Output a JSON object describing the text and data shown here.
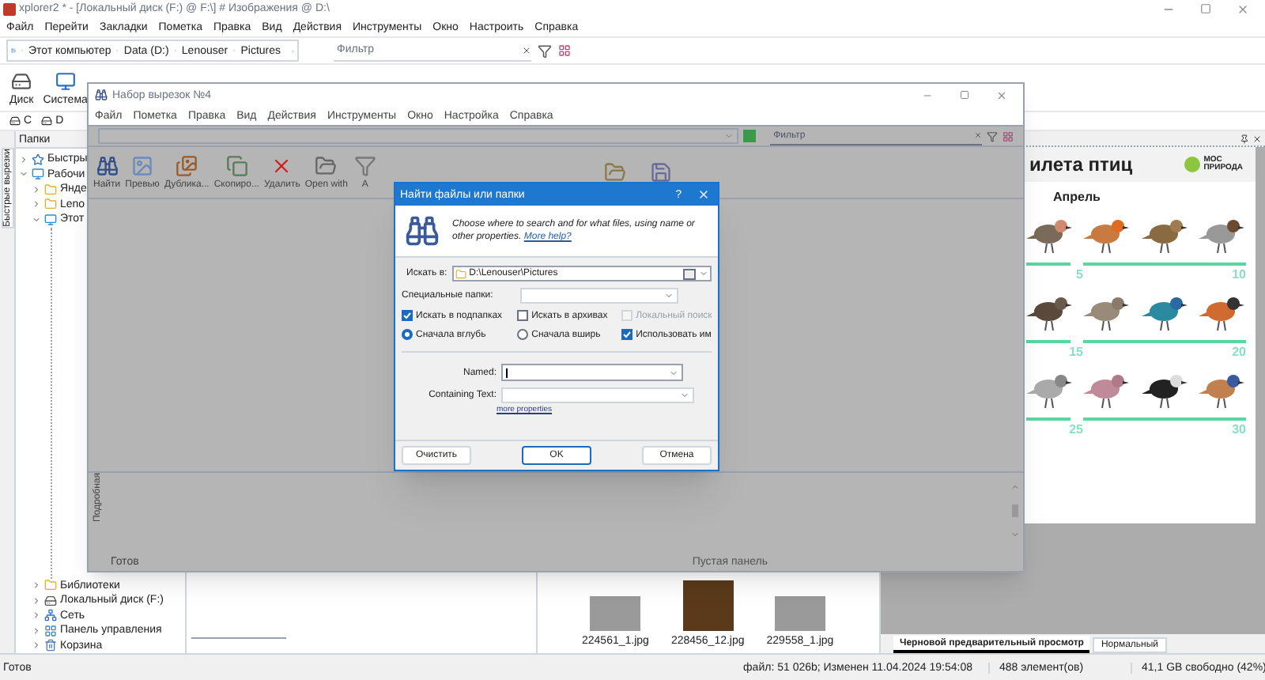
{
  "main_window": {
    "title": "xplorer2 * - [Локальный диск (F:) @ F:\\] # Изображения @ D:\\",
    "menu": [
      "Файл",
      "Перейти",
      "Закладки",
      "Пометка",
      "Правка",
      "Вид",
      "Действия",
      "Инструменты",
      "Окно",
      "Настроить",
      "Справка"
    ],
    "address": [
      "Этот компьютер",
      "Data (D:)",
      "Lenouser",
      "Pictures"
    ],
    "filter": {
      "placeholder": "Фильтр"
    },
    "toolbar": [
      {
        "label": "Диск",
        "kind": "drive"
      },
      {
        "label": "Система",
        "kind": "computer"
      }
    ],
    "drives": [
      "C",
      "D"
    ],
    "side_tab": "Быстрые вырезки",
    "folders": {
      "title": "Папки",
      "tree": [
        {
          "label": "Быстры",
          "expanded": false,
          "kind": "star"
        },
        {
          "label": "Рабочи",
          "expanded": true,
          "kind": "desktop",
          "children": [
            {
              "label": "Янде",
              "expanded": false,
              "kind": "folder"
            },
            {
              "label": "Leno",
              "expanded": false,
              "kind": "folder"
            },
            {
              "label": "Этот",
              "expanded": true,
              "kind": "desktop"
            },
            {
              "label": "Библиотеки",
              "expanded": false,
              "kind": "folder"
            },
            {
              "label": "Локальный диск (F:)",
              "expanded": false,
              "kind": "drive"
            },
            {
              "label": "Сеть",
              "expanded": false,
              "kind": "network"
            },
            {
              "label": "Панель управления",
              "expanded": false,
              "kind": "panel"
            },
            {
              "label": "Корзина",
              "expanded": false,
              "kind": "trash"
            }
          ]
        }
      ]
    },
    "thumbnails": [
      {
        "name": "224561_1.jpg"
      },
      {
        "name": "228456_12.jpg"
      },
      {
        "name": "229558_1.jpg"
      }
    ],
    "preview": {
      "title": "илета птиц",
      "logo": [
        "МОС",
        "ПРИРОДА"
      ],
      "month": "Апрель",
      "rows": [
        {
          "numbers": [
            "5",
            "10"
          ]
        },
        {
          "numbers": [
            "15",
            "20"
          ]
        },
        {
          "numbers": [
            "25",
            "30"
          ]
        }
      ]
    },
    "preview_tabs": [
      {
        "label": "Черновой предварительный просмотр",
        "selected": true
      },
      {
        "label": "Нормальный",
        "selected": false
      }
    ],
    "status_bar": [
      "Готов",
      "файл: 51 026b; Изменен 11.04.2024 19:54:08",
      "488 элемент(ов)",
      "41,1 GB свободно (42%)"
    ]
  },
  "clip_window": {
    "title": "Набор вырезок №4",
    "menu": [
      "Файл",
      "Пометка",
      "Правка",
      "Вид",
      "Действия",
      "Инструменты",
      "Окно",
      "Настройка",
      "Справка"
    ],
    "filter": {
      "placeholder": "Фильтр"
    },
    "toolbar": [
      {
        "label": "Найти",
        "kind": "binoculars"
      },
      {
        "label": "Превью",
        "kind": "preview"
      },
      {
        "label": "Дублика...",
        "kind": "photos"
      },
      {
        "label": "Скопиро...",
        "kind": "copy"
      },
      {
        "label": "Удалить",
        "kind": "delete"
      },
      {
        "label": "Open with",
        "kind": "open"
      },
      {
        "label": "A",
        "kind": "filter"
      }
    ],
    "side_tab": "Подробная",
    "empty_panel": "Пустая панель",
    "status": "Готов"
  },
  "dialog": {
    "title": "Найти файлы или папки",
    "help": "?",
    "intro": "Choose where to search and for what files, using name or other properties.",
    "help_link": "More help?",
    "look_in": {
      "label": "Искать в:",
      "value": "D:\\Lenouser\\Pictures"
    },
    "special": {
      "label": "Специальные папки:"
    },
    "options": [
      {
        "kind": "checkbox",
        "label": "Искать в подпапках",
        "checked": true,
        "disabled": false
      },
      {
        "kind": "checkbox",
        "label": "Искать в архивах",
        "checked": false,
        "disabled": false
      },
      {
        "kind": "checkbox",
        "label": "Локальный поиск",
        "checked": false,
        "disabled": true
      },
      {
        "kind": "radio",
        "label": "Сначала вглубь",
        "selected": true
      },
      {
        "kind": "radio",
        "label": "Сначала вширь",
        "selected": false
      },
      {
        "kind": "checkbox",
        "label": "Использовать им",
        "checked": true,
        "disabled": false
      }
    ],
    "named": {
      "label": "Named:"
    },
    "containing": {
      "label": "Containing Text:"
    },
    "more_link": "more properties",
    "buttons": [
      {
        "label": "Очистить",
        "default": false
      },
      {
        "label": "OK",
        "default": true
      },
      {
        "label": "Отмена",
        "default": false
      }
    ]
  }
}
